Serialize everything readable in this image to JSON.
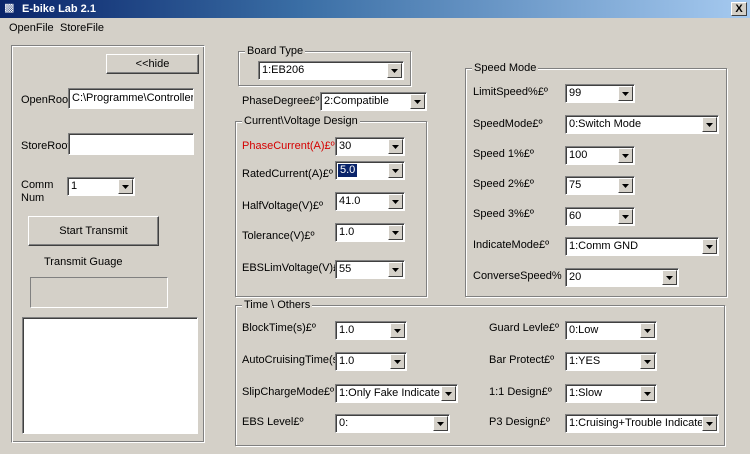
{
  "window": {
    "title": "E-bike Lab 2.1",
    "close_label": "X"
  },
  "menu": {
    "open": "OpenFile",
    "store": "StoreFile"
  },
  "left": {
    "hide_label": "<<hide",
    "open_root_label": "OpenRoot",
    "open_root_value": "C:\\Programme\\Controller I",
    "store_root_label": "StoreRoot",
    "store_root_value": "",
    "comm_num_label": "Comm\nNum",
    "comm_num_value": "1",
    "start_label": "Start Transmit",
    "gauge_label": "Transmit Guage",
    "gauge_progress": 0
  },
  "board": {
    "group_title": "Board Type",
    "value": "1:EB206"
  },
  "phase": {
    "label": "PhaseDegree£º",
    "value": "2:Compatible"
  },
  "current_voltage": {
    "group_title": "Current\\Voltage Design",
    "phase_current": {
      "label": "PhaseCurrent(A)£º",
      "value": "30"
    },
    "rated_current": {
      "label": "RatedCurrent(A)£º",
      "value": "5.0"
    },
    "half_voltage": {
      "label": "HalfVoltage(V)£º",
      "value": "41.0"
    },
    "tolerance": {
      "label": "Tolerance(V)£º",
      "value": "1.0"
    },
    "ebs_lim": {
      "label": "EBSLimVoltage(V)£º",
      "value": "55"
    }
  },
  "speed_mode": {
    "group_title": "Speed Mode",
    "limit_speed": {
      "label": "LimitSpeed%£º",
      "value": "99"
    },
    "speed_mode": {
      "label": "SpeedMode£º",
      "value": "0:Switch Mode"
    },
    "speed1": {
      "label": "Speed 1%£º",
      "value": "100"
    },
    "speed2": {
      "label": "Speed 2%£º",
      "value": "75"
    },
    "speed3": {
      "label": "Speed 3%£º",
      "value": "60"
    },
    "indicate_mode": {
      "label": "IndicateMode£º",
      "value": "1:Comm GND"
    },
    "converse_speed": {
      "label": "ConverseSpeed%",
      "value": "20"
    }
  },
  "time_others": {
    "group_title": "Time \\ Others",
    "block_time": {
      "label": "BlockTime(s)£º",
      "value": "1.0"
    },
    "auto_cruising": {
      "label": "AutoCruisingTime(s)£º",
      "value": "1.0"
    },
    "slip_charge": {
      "label": "SlipChargeMode£º",
      "value": "1:Only Fake Indicate"
    },
    "ebs_level": {
      "label": "EBS Level£º",
      "value": "0:"
    },
    "guard_level": {
      "label": "Guard Levle£º",
      "value": "0:Low"
    },
    "bar_protect": {
      "label": "Bar Protect£º",
      "value": "1:YES"
    },
    "design_11": {
      "label": "1:1 Design£º",
      "value": "1:Slow"
    },
    "p3_design": {
      "label": "P3 Design£º",
      "value": "1:Cruising+Trouble Indicate"
    }
  },
  "colors": {
    "face": "#d4d0c8",
    "title_start": "#0a246a",
    "title_end": "#a6caf0",
    "highlight": "#0a246a",
    "alert_text": "#d40000"
  },
  "icons": {
    "app": "bike-app-icon",
    "dropdown": "chevron-down-icon",
    "close": "close-icon"
  }
}
